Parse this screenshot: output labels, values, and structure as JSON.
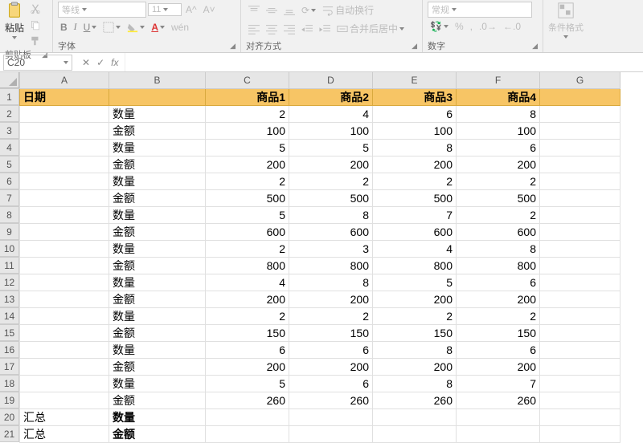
{
  "ribbon": {
    "clipboard": {
      "title": "剪贴板",
      "paste": "粘贴"
    },
    "font": {
      "title": "字体",
      "name": "等线",
      "size": "11",
      "bold": "B",
      "italic": "I",
      "underline": "U"
    },
    "align": {
      "title": "对齐方式",
      "wrap": "自动换行",
      "merge": "合并后居中"
    },
    "number": {
      "title": "数字",
      "format": "常规",
      "percent": "%"
    },
    "styles": {
      "cond": "条件格式"
    }
  },
  "formula_bar": {
    "namebox": "C20",
    "fx": "fx"
  },
  "columns": [
    "A",
    "B",
    "C",
    "D",
    "E",
    "F",
    "G"
  ],
  "header_row": {
    "A": "日期",
    "C": "商品1",
    "D": "商品2",
    "E": "商品3",
    "F": "商品4"
  },
  "rows": [
    {
      "B": "数量",
      "C": 2,
      "D": 4,
      "E": 6,
      "F": 8
    },
    {
      "B": "金额",
      "C": 100,
      "D": 100,
      "E": 100,
      "F": 100
    },
    {
      "B": "数量",
      "C": 5,
      "D": 5,
      "E": 8,
      "F": 6
    },
    {
      "B": "金额",
      "C": 200,
      "D": 200,
      "E": 200,
      "F": 200
    },
    {
      "B": "数量",
      "C": 2,
      "D": 2,
      "E": 2,
      "F": 2
    },
    {
      "B": "金额",
      "C": 500,
      "D": 500,
      "E": 500,
      "F": 500
    },
    {
      "B": "数量",
      "C": 5,
      "D": 8,
      "E": 7,
      "F": 2
    },
    {
      "B": "金额",
      "C": 600,
      "D": 600,
      "E": 600,
      "F": 600
    },
    {
      "B": "数量",
      "C": 2,
      "D": 3,
      "E": 4,
      "F": 8
    },
    {
      "B": "金额",
      "C": 800,
      "D": 800,
      "E": 800,
      "F": 800
    },
    {
      "B": "数量",
      "C": 4,
      "D": 8,
      "E": 5,
      "F": 6
    },
    {
      "B": "金额",
      "C": 200,
      "D": 200,
      "E": 200,
      "F": 200
    },
    {
      "B": "数量",
      "C": 2,
      "D": 2,
      "E": 2,
      "F": 2
    },
    {
      "B": "金额",
      "C": 150,
      "D": 150,
      "E": 150,
      "F": 150
    },
    {
      "B": "数量",
      "C": 6,
      "D": 6,
      "E": 8,
      "F": 6
    },
    {
      "B": "金额",
      "C": 200,
      "D": 200,
      "E": 200,
      "F": 200
    },
    {
      "B": "数量",
      "C": 5,
      "D": 6,
      "E": 8,
      "F": 7
    },
    {
      "B": "金额",
      "C": 260,
      "D": 260,
      "E": 260,
      "F": 260
    }
  ],
  "totals": [
    {
      "A": "汇总",
      "B": "数量"
    },
    {
      "A": "汇总",
      "B": "金额"
    }
  ],
  "chart_data": {
    "type": "table",
    "title": "",
    "columns": [
      "商品1",
      "商品2",
      "商品3",
      "商品4"
    ],
    "row_labels": [
      "数量",
      "金额",
      "数量",
      "金额",
      "数量",
      "金额",
      "数量",
      "金额",
      "数量",
      "金额",
      "数量",
      "金额",
      "数量",
      "金额",
      "数量",
      "金额",
      "数量",
      "金额"
    ],
    "values": [
      [
        2,
        4,
        6,
        8
      ],
      [
        100,
        100,
        100,
        100
      ],
      [
        5,
        5,
        8,
        6
      ],
      [
        200,
        200,
        200,
        200
      ],
      [
        2,
        2,
        2,
        2
      ],
      [
        500,
        500,
        500,
        500
      ],
      [
        5,
        8,
        7,
        2
      ],
      [
        600,
        600,
        600,
        600
      ],
      [
        2,
        3,
        4,
        8
      ],
      [
        800,
        800,
        800,
        800
      ],
      [
        4,
        8,
        5,
        6
      ],
      [
        200,
        200,
        200,
        200
      ],
      [
        2,
        2,
        2,
        2
      ],
      [
        150,
        150,
        150,
        150
      ],
      [
        6,
        6,
        8,
        6
      ],
      [
        200,
        200,
        200,
        200
      ],
      [
        5,
        6,
        8,
        7
      ],
      [
        260,
        260,
        260,
        260
      ]
    ]
  }
}
